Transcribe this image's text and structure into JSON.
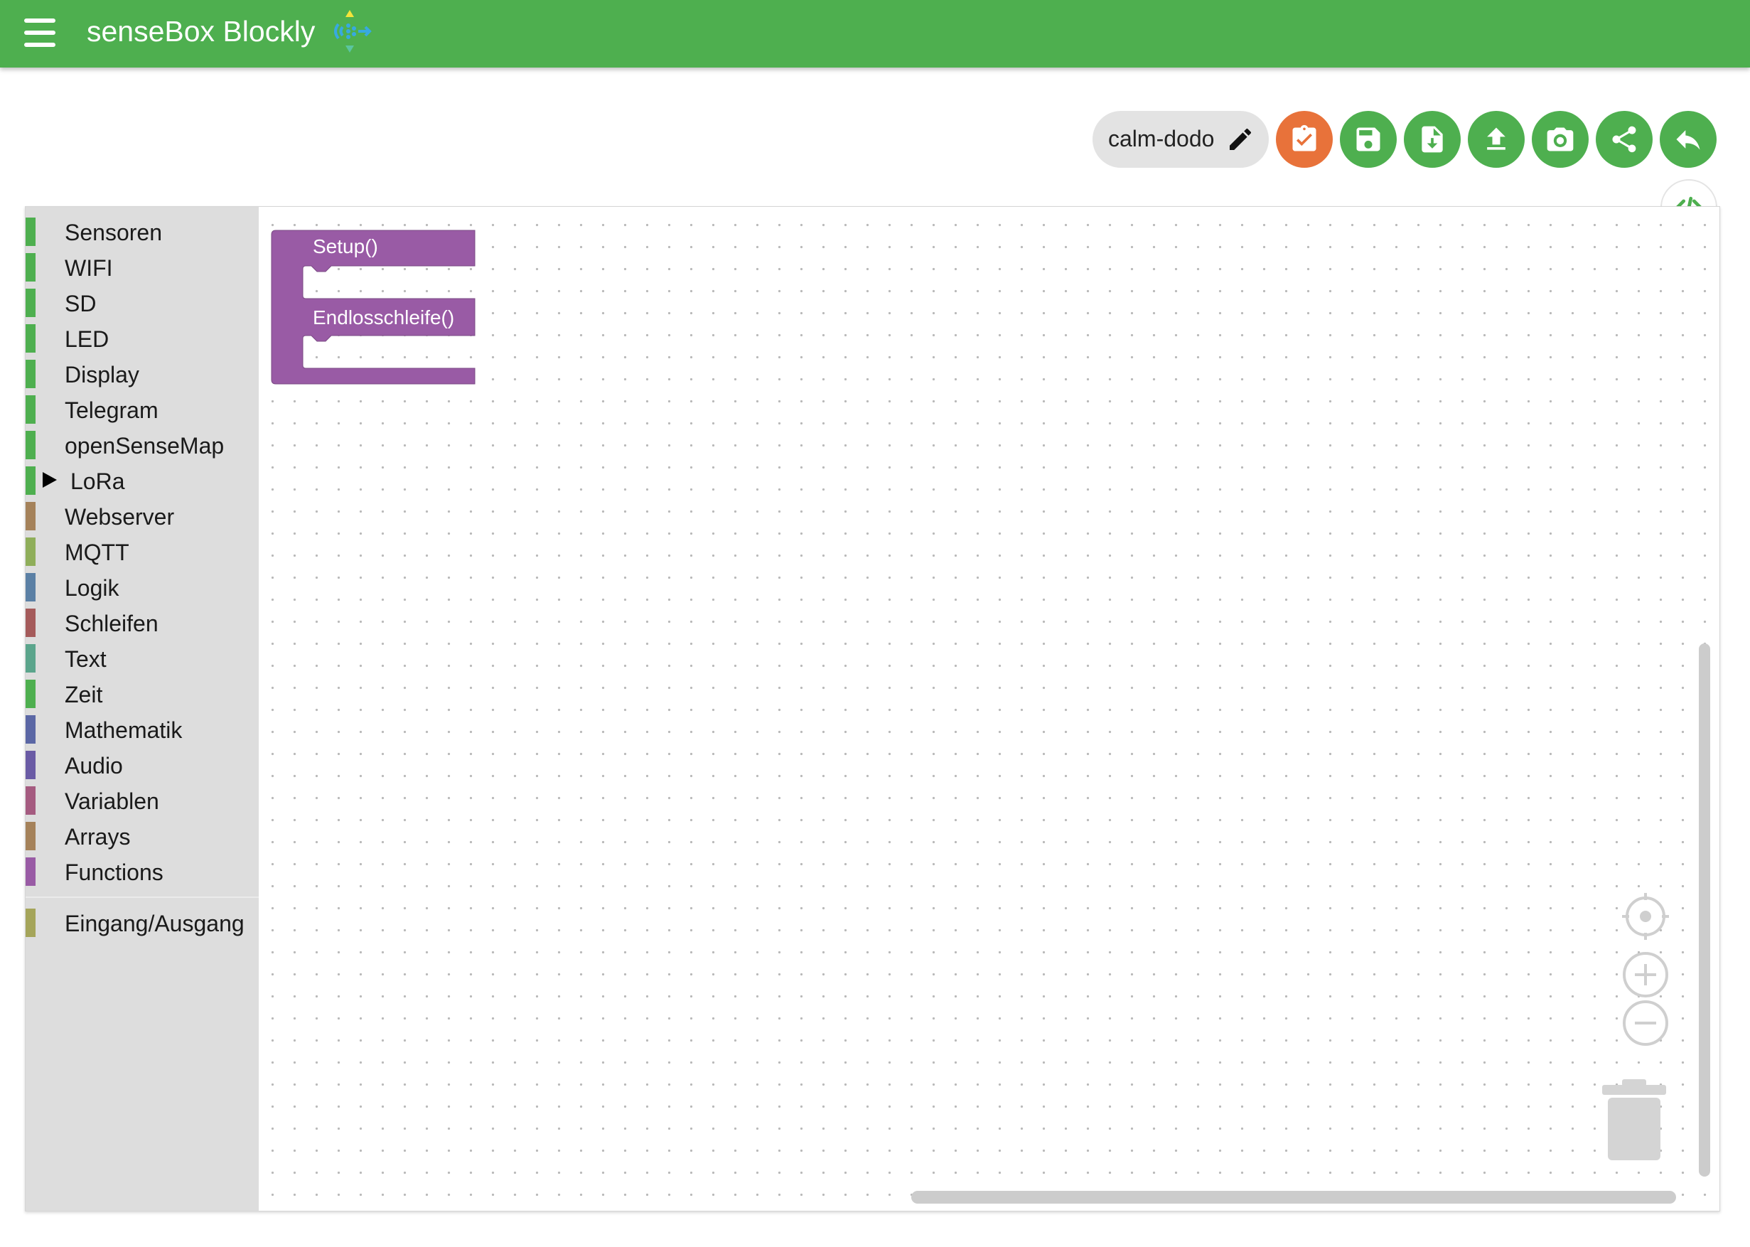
{
  "app": {
    "title": "senseBox Blockly",
    "menu_icon": "menu-icon",
    "brand_color": "#4eaf4f"
  },
  "toolbar": {
    "project_name": "calm-dodo",
    "buttons": [
      {
        "name": "compile",
        "icon": "clipboard-check-icon",
        "color": "#e8723a"
      },
      {
        "name": "save",
        "icon": "save-icon",
        "color": "#4eaf4f"
      },
      {
        "name": "download",
        "icon": "file-download-icon",
        "color": "#4eaf4f"
      },
      {
        "name": "upload",
        "icon": "upload-icon",
        "color": "#4eaf4f"
      },
      {
        "name": "screenshot",
        "icon": "camera-icon",
        "color": "#4eaf4f"
      },
      {
        "name": "share",
        "icon": "share-icon",
        "color": "#4eaf4f"
      },
      {
        "name": "undo",
        "icon": "undo-icon",
        "color": "#4eaf4f"
      }
    ],
    "code_toggle_icon": "code-icon"
  },
  "toolbox": {
    "categories": [
      {
        "label": "Sensoren",
        "color": "#4eaf4f"
      },
      {
        "label": "WIFI",
        "color": "#4eaf4f"
      },
      {
        "label": "SD",
        "color": "#4eaf4f"
      },
      {
        "label": "LED",
        "color": "#4eaf4f"
      },
      {
        "label": "Display",
        "color": "#4eaf4f"
      },
      {
        "label": "Telegram",
        "color": "#4eaf4f"
      },
      {
        "label": "openSenseMap",
        "color": "#4eaf4f"
      },
      {
        "label": "LoRa",
        "color": "#4eaf4f",
        "expandable": true
      },
      {
        "label": "Webserver",
        "color": "#a5825a"
      },
      {
        "label": "MQTT",
        "color": "#8fae5a"
      },
      {
        "label": "Logik",
        "color": "#5b80a5"
      },
      {
        "label": "Schleifen",
        "color": "#a55b5b"
      },
      {
        "label": "Text",
        "color": "#5ba58c"
      },
      {
        "label": "Zeit",
        "color": "#4eaf4f"
      },
      {
        "label": "Mathematik",
        "color": "#5b67a5"
      },
      {
        "label": "Audio",
        "color": "#6a5ba5"
      },
      {
        "label": "Variablen",
        "color": "#a55b80"
      },
      {
        "label": "Arrays",
        "color": "#a5825a"
      },
      {
        "label": "Functions",
        "color": "#995ba5"
      }
    ],
    "extra_category": {
      "label": "Eingang/Ausgang",
      "color": "#a5a55a"
    }
  },
  "workspace": {
    "blocks": {
      "setup_label": "Setup()",
      "loop_label": "Endlosschleife()",
      "color": "#995ba5"
    },
    "controls": {
      "recenter": "recenter-icon",
      "zoom_in": "zoom-in-icon",
      "zoom_out": "zoom-out-icon",
      "trash": "trash-icon"
    }
  }
}
